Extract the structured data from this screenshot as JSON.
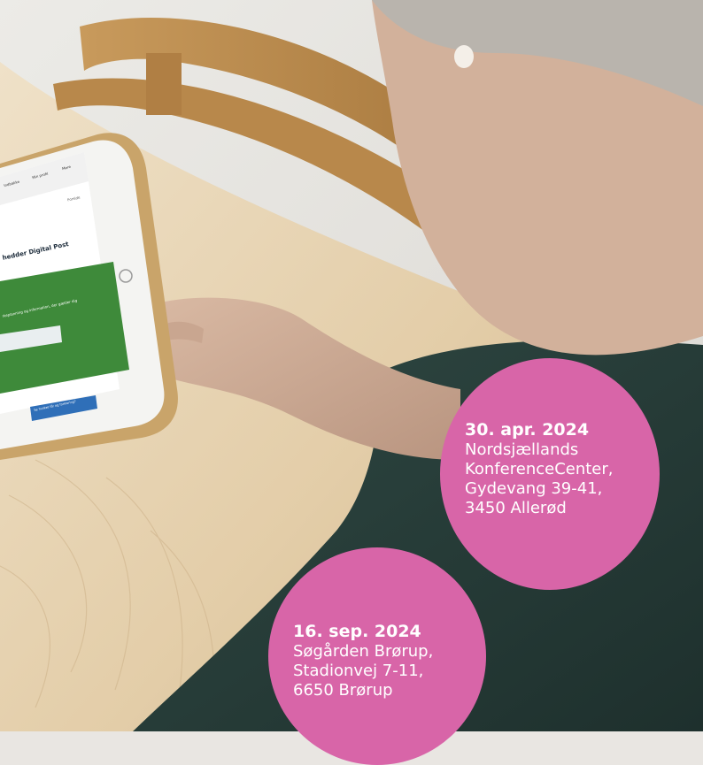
{
  "events": [
    {
      "date": "30. apr. 2024",
      "lines": [
        "Nordsjællands",
        "KonferenceCenter,",
        "Gydevang 39-41,",
        "3450 Allerød"
      ]
    },
    {
      "date": "16. sep. 2024",
      "lines": [
        "Søgården Brørup,",
        "Stadionvej 7-11,",
        "6650 Brørup"
      ]
    }
  ],
  "tablet_screen": {
    "heading": "hedder Digital Post",
    "body_text": "rkeplanning og information, der gælder dig",
    "button_label": "Se hvilket får og forklaring?",
    "top_right_link": "Forside",
    "nav": [
      "Indbakke",
      "Min profil",
      "Mere"
    ]
  },
  "colors": {
    "badge": "#d865a8",
    "tablet_panel": "#3e8a3a",
    "tablet_button": "#2f6fb8"
  }
}
